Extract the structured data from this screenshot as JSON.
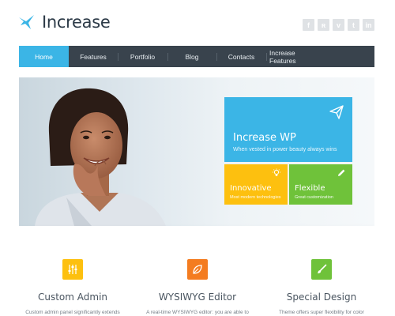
{
  "header": {
    "logo_text": "Increase",
    "social": [
      {
        "icon": "facebook-icon",
        "glyph": "f"
      },
      {
        "icon": "rss-icon",
        "glyph": "ʀ"
      },
      {
        "icon": "vimeo-icon",
        "glyph": "v"
      },
      {
        "icon": "twitter-icon",
        "glyph": "t"
      },
      {
        "icon": "linkedin-icon",
        "glyph": "in"
      }
    ]
  },
  "nav": {
    "items": [
      "Home",
      "Features",
      "Portfolio",
      "Blog",
      "Contacts",
      "Increase Features"
    ],
    "active": "Home"
  },
  "hero": {
    "main_tile": {
      "title": "Increase WP",
      "subtitle": "When vested in power beauty always wins",
      "icon": "paper-plane-icon"
    },
    "tile_left": {
      "title": "Innovative",
      "subtitle": "Most modern technologies",
      "icon": "lightbulb-icon"
    },
    "tile_right": {
      "title": "Flexible",
      "subtitle": "Great customization",
      "icon": "pencil-icon"
    }
  },
  "features": [
    {
      "title": "Custom Admin",
      "text": "Custom admin panel significantly extends",
      "icon": "sliders-icon"
    },
    {
      "title": "WYSIWYG Editor",
      "text": "A real-time WYSIWYG editor: you are able to",
      "icon": "leaf-icon"
    },
    {
      "title": "Special Design",
      "text": "Theme offers super flexibility for color",
      "icon": "brush-icon"
    }
  ],
  "colors": {
    "accent_blue": "#3bb5e6",
    "nav_dark": "#39434d",
    "yellow": "#fdc00f",
    "green": "#6fc23a",
    "orange": "#f47c20"
  }
}
